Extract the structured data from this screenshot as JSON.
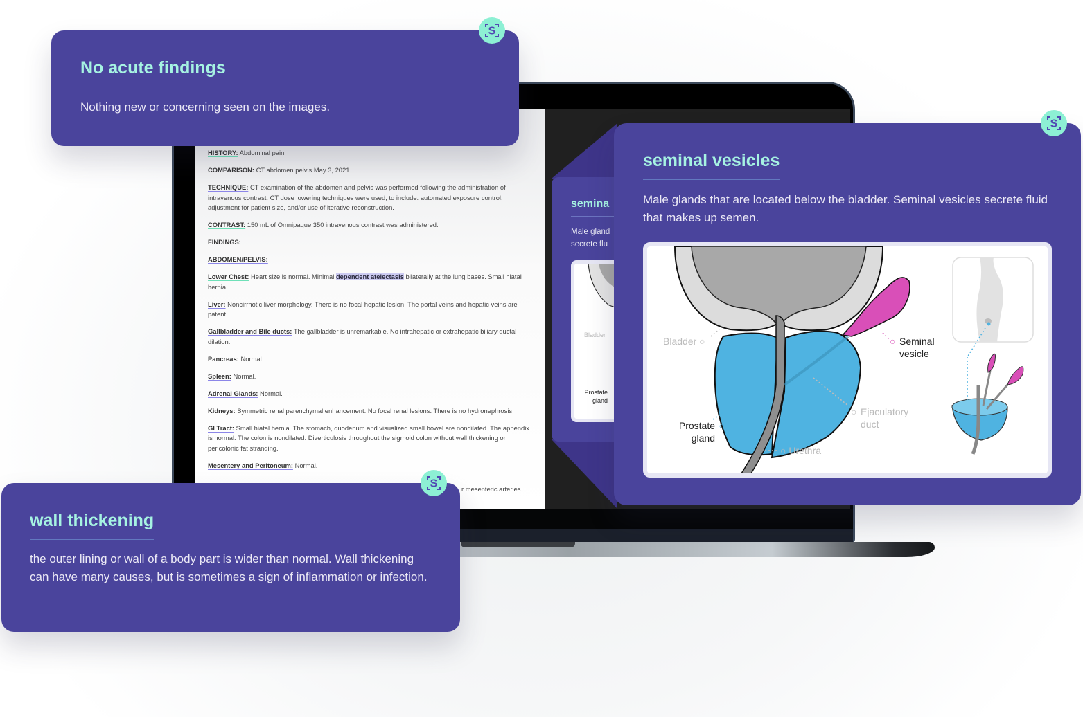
{
  "brand": {
    "badge_letter": "S",
    "colors": {
      "card_bg": "#4a449c",
      "title": "#a6f3e2",
      "badge_bg": "#8df0d4",
      "prostate_blue": "#4fb3e1",
      "seminal_magenta": "#d94fb8"
    }
  },
  "report": {
    "paragraphs": [
      {
        "label": "HISTORY:",
        "text": "Abdominal pain."
      },
      {
        "label": "COMPARISON:",
        "text": "CT abdomen pelvis May 3, 2021"
      },
      {
        "label": "TECHNIQUE:",
        "text": "CT examination of the abdomen and pelvis was performed following the administration of intravenous contrast. CT dose lowering techniques were used, to include: automated exposure control, adjustment for patient size, and/or use of iterative reconstruction."
      },
      {
        "label": "CONTRAST:",
        "text": "150 mL of Omnipaque 350 intravenous contrast was administered."
      },
      {
        "label": "FINDINGS:",
        "text": ""
      },
      {
        "label": "ABDOMEN/PELVIS:",
        "text": ""
      },
      {
        "label": "Lower Chest:",
        "text_before": "Heart size is normal. Minimal",
        "highlight": "dependent atelectasis",
        "text_after": "bilaterally at the lung bases. Small hiatal hernia."
      },
      {
        "label": "Liver:",
        "text": "Noncirrhotic liver morphology. There is no focal hepatic lesion. The portal veins and hepatic veins are patent."
      },
      {
        "label": "Gallbladder and Bile ducts:",
        "text": "The gallbladder is unremarkable. No intrahepatic or extrahepatic biliary ductal dilation."
      },
      {
        "label": "Pancreas:",
        "text": "Normal."
      },
      {
        "label": "Spleen:",
        "text": "Normal."
      },
      {
        "label": "Adrenal Glands:",
        "text": "Normal."
      },
      {
        "label": "Kidneys:",
        "text": "Symmetric renal parenchymal enhancement. No focal renal lesions. There is no hydronephrosis."
      },
      {
        "label": "GI Tract:",
        "text": "Small hiatal hernia. The stomach, duodenum and visualized small bowel are nondilated. The appendix is normal. The colon is nondilated. Diverticulosis throughout the sigmoid colon without wall thickening or pericolonic fat stranding."
      },
      {
        "label": "Mesentery and Peritoneum:",
        "text": "Normal."
      }
    ],
    "tail_text": "r mesenteric arteries"
  },
  "cards": {
    "no_acute": {
      "title": "No acute findings",
      "description": "Nothing new or concerning seen on the images."
    },
    "wall_thickening": {
      "title": "wall thickening",
      "description": "the outer lining or wall of a body part is wider than normal. Wall thickening can have many causes, but is sometimes a sign of inflammation or infection."
    },
    "seminal_vesicles": {
      "title": "seminal vesicles",
      "description": "Male glands that are located below the bladder. Seminal vesicles secrete fluid that makes up semen.",
      "illustration_labels": {
        "bladder": "Bladder",
        "seminal_vesicle": "Seminal vesicle",
        "ejaculatory_duct": "Ejaculatory duct",
        "prostate_gland": "Prostate gland",
        "urethra": "Urethra"
      }
    },
    "ghost": {
      "title": "semina",
      "description_line1": "Male gland",
      "description_line2": "secrete flu",
      "bladder": "Bladder",
      "prostate_line1": "Prostate",
      "prostate_line2": "gland"
    }
  }
}
